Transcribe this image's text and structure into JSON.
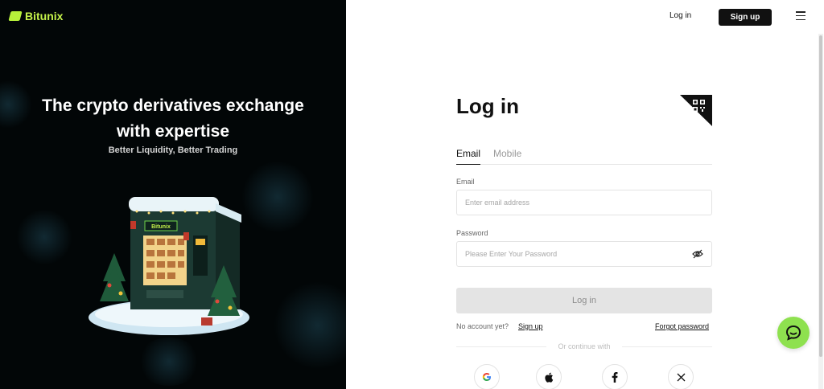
{
  "brand": {
    "name": "Bitunix",
    "accent": "#b6f03a"
  },
  "hero": {
    "title_line1": "The crypto derivatives exchange",
    "title_line2": "with expertise",
    "subtitle": "Better Liquidity, Better Trading",
    "illustration": "vending-machine-christmas"
  },
  "topbar": {
    "login_label": "Log in",
    "signup_label": "Sign up",
    "menu_icon": "hamburger-icon"
  },
  "form": {
    "title": "Log in",
    "qr_icon": "qr-code-icon",
    "tabs": [
      {
        "label": "Email",
        "active": true
      },
      {
        "label": "Mobile",
        "active": false
      }
    ],
    "email_label": "Email",
    "email_placeholder": "Enter email address",
    "password_label": "Password",
    "password_placeholder": "Please Enter Your Password",
    "submit_label": "Log in",
    "no_account_text": "No account yet?",
    "signup_link": "Sign up",
    "forgot_link": "Forgot password",
    "divider_text": "Or continue with",
    "social": [
      "google-icon",
      "apple-icon",
      "facebook-icon",
      "x-icon"
    ]
  },
  "chat": {
    "icon": "chat-bubble-icon",
    "color": "#8ee14f"
  }
}
